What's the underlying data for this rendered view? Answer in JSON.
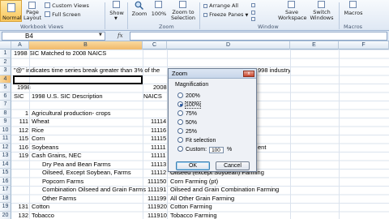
{
  "ribbon": {
    "normal": "Normal",
    "page_layout": "Page\nLayout",
    "custom_views": "Custom Views",
    "full_screen": "Full Screen",
    "workbook_views_label": "Workbook Views",
    "show": "Show",
    "zoom": "Zoom",
    "zoom_100": "100%",
    "zoom_to_selection": "Zoom to\nSelection",
    "zoom_group_label": "Zoom",
    "arrange_all": "Arrange All",
    "freeze_panes": "Freeze Panes",
    "window_group_label": "Window",
    "save_workspace": "Save\nWorkspace",
    "switch_windows": "Switch\nWindows",
    "macros": "Macros",
    "macros_group_label": "Macros"
  },
  "formula_bar": {
    "name_box": "B4",
    "fx": "fx",
    "formula": ""
  },
  "columns": [
    "A",
    "B",
    "C",
    "D",
    "E",
    "F"
  ],
  "rows": [
    "1",
    "2",
    "3",
    "4",
    "5",
    "6",
    "7",
    "8",
    "9",
    "10",
    "11",
    "12",
    "13",
    "14",
    "15",
    "16",
    "17",
    "18",
    "19",
    "20"
  ],
  "cells": {
    "r1": "1998 SIC Matched to 2008 NAICS",
    "r3": "\"@\" indicates time series break greater than 3% of the",
    "r3_tail": "998 industry",
    "r5_a": "1998",
    "r5_c": "2008",
    "r6_a": "SIC",
    "r6_b": "1998 U.S. SIC Description",
    "r6_c": "NAICS",
    "r8_a": "1",
    "r8_b": "Agricultural production- crops",
    "r9_a": "111",
    "r9_b": "Wheat",
    "r9_c": "11114",
    "r10_a": "112",
    "r10_b": "Rice",
    "r10_c": "11116",
    "r11_a": "115",
    "r11_b": "Corn",
    "r11_c": "11115",
    "r12_a": "116",
    "r12_b": "Soybeans",
    "r12_c": "11111",
    "r12_d": "ent",
    "r13_a": "119",
    "r13_b": "Cash Grains, NEC",
    "r13_c": "11111",
    "r14_b": "Dry Pea and Bean Farms",
    "r14_c": "11113",
    "r15_b": "Oilseed, Except Soybean, Farms",
    "r15_c": "11112",
    "r15_d": "Oilseed (except Soybean) Farming",
    "r16_b": "Popcorn Farms",
    "r16_c": "111150",
    "r16_d": "Corn Farming (pt)",
    "r17_b": "Combination Oilseed and Grain Farms",
    "r17_c": "111191",
    "r17_d": "Oilseed and Grain Combination Farming",
    "r18_b": "Other Farms",
    "r18_c": "111199",
    "r18_d": "All Other Grain Farming",
    "r19_a": "131",
    "r19_b": "Cotton",
    "r19_c": "111920",
    "r19_d": "Cotton Farming",
    "r20_a": "132",
    "r20_b": "Tobacco",
    "r20_c": "111910",
    "r20_d": "Tobacco Farming"
  },
  "dialog": {
    "title": "Zoom",
    "close": "x",
    "magnification": "Magnification",
    "options": [
      "200%",
      "100%",
      "75%",
      "50%",
      "25%",
      "Fit selection",
      "Custom:"
    ],
    "custom_value": "100",
    "custom_unit": "%",
    "ok": "OK",
    "cancel": "Cancel"
  }
}
